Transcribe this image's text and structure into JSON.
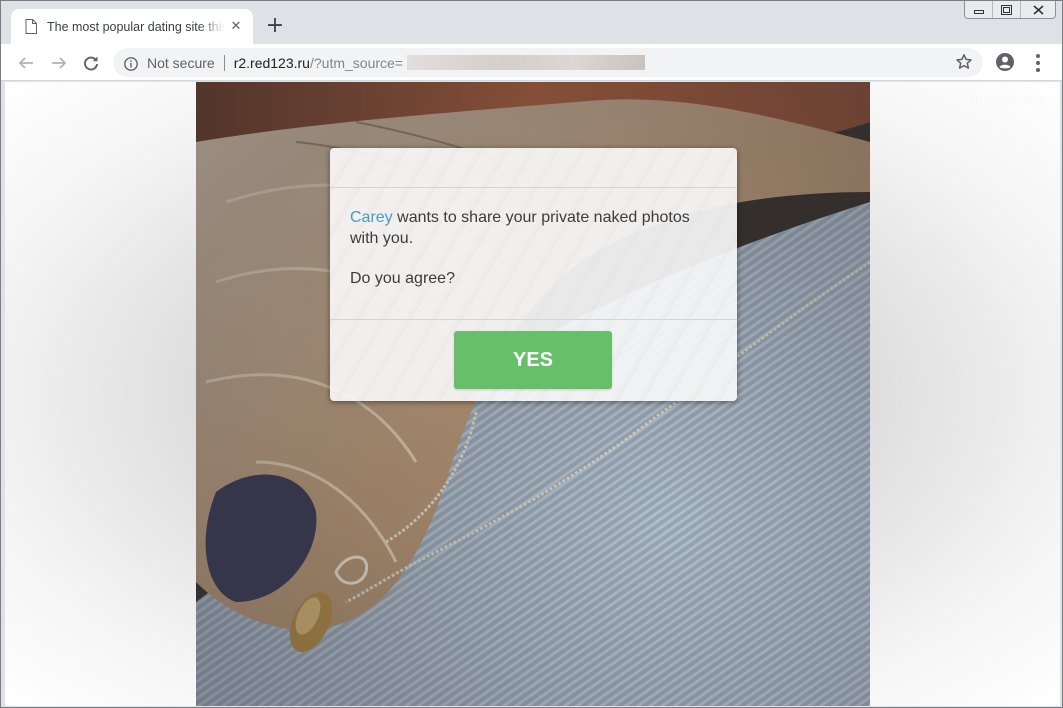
{
  "browser": {
    "tab": {
      "title": "The most popular dating site this",
      "close_glyph": "✕"
    },
    "new_tab_glyph": "+",
    "window_controls": {
      "minimize": "▭",
      "restore": "⧉",
      "close": "✕"
    },
    "address_bar": {
      "security_label": "Not secure",
      "host": "r2.red123.ru",
      "path": "/?utm_source="
    }
  },
  "page": {
    "unsubscribe_label": "unsubscribe",
    "dialog": {
      "sender_name": "Carey",
      "message": " wants to share your private naked photos with you.",
      "question": "Do you agree?",
      "yes_label": "YES"
    }
  },
  "colors": {
    "accent_green": "#67bf6a",
    "name_blue": "#4a98c9"
  },
  "icons": [
    "document-icon",
    "close-icon",
    "plus-icon",
    "back-arrow-icon",
    "forward-arrow-icon",
    "reload-icon",
    "info-icon",
    "star-icon",
    "account-icon",
    "menu-dots-icon"
  ]
}
